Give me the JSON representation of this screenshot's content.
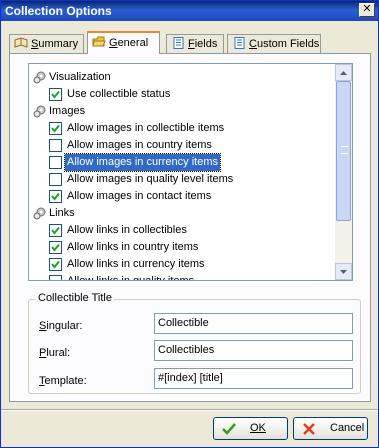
{
  "window": {
    "title": "Collection Options",
    "close_glyph": "✕"
  },
  "tabs": [
    {
      "label": "Summary",
      "mnemonic": "S",
      "rest": "ummary",
      "icon": "book-icon",
      "active": false
    },
    {
      "label": "General",
      "mnemonic": "G",
      "rest": "eneral",
      "icon": "folder-icon",
      "active": true
    },
    {
      "label": "Fields",
      "mnemonic": "F",
      "rest": "ields",
      "icon": "document-icon",
      "active": false
    },
    {
      "label": "Custom Fields",
      "mnemonic": "C",
      "rest": "ustom Fields",
      "icon": "document-icon",
      "active": false
    }
  ],
  "options_list": {
    "groups": [
      {
        "label": "Visualization",
        "icon": "gears-icon",
        "items": [
          {
            "label": "Use collectible status",
            "checked": true
          }
        ]
      },
      {
        "label": "Images",
        "icon": "gears-icon",
        "items": [
          {
            "label": "Allow images in collectible items",
            "checked": true
          },
          {
            "label": "Allow images in country items",
            "checked": false
          },
          {
            "label": "Allow images in currency items",
            "checked": false,
            "selected": true
          },
          {
            "label": "Allow images in quality level items",
            "checked": false
          },
          {
            "label": "Allow images in contact items",
            "checked": true
          }
        ]
      },
      {
        "label": "Links",
        "icon": "gears-icon",
        "items": [
          {
            "label": "Allow links in collectibles",
            "checked": true
          },
          {
            "label": "Allow links in country items",
            "checked": true
          },
          {
            "label": "Allow links in currency items",
            "checked": true
          },
          {
            "label": "Allow links in quality items",
            "checked": false
          }
        ]
      }
    ]
  },
  "collectible_title": {
    "title": "Collectible Title",
    "singular_label": "Singular:",
    "singular_value": "Collectible",
    "plural_label": "Plural:",
    "plural_value": "Collectibles",
    "template_label": "Template:",
    "template_value": "#[index] [title]"
  },
  "footer": {
    "ok_label": "OK",
    "cancel_label": "Cancel"
  }
}
